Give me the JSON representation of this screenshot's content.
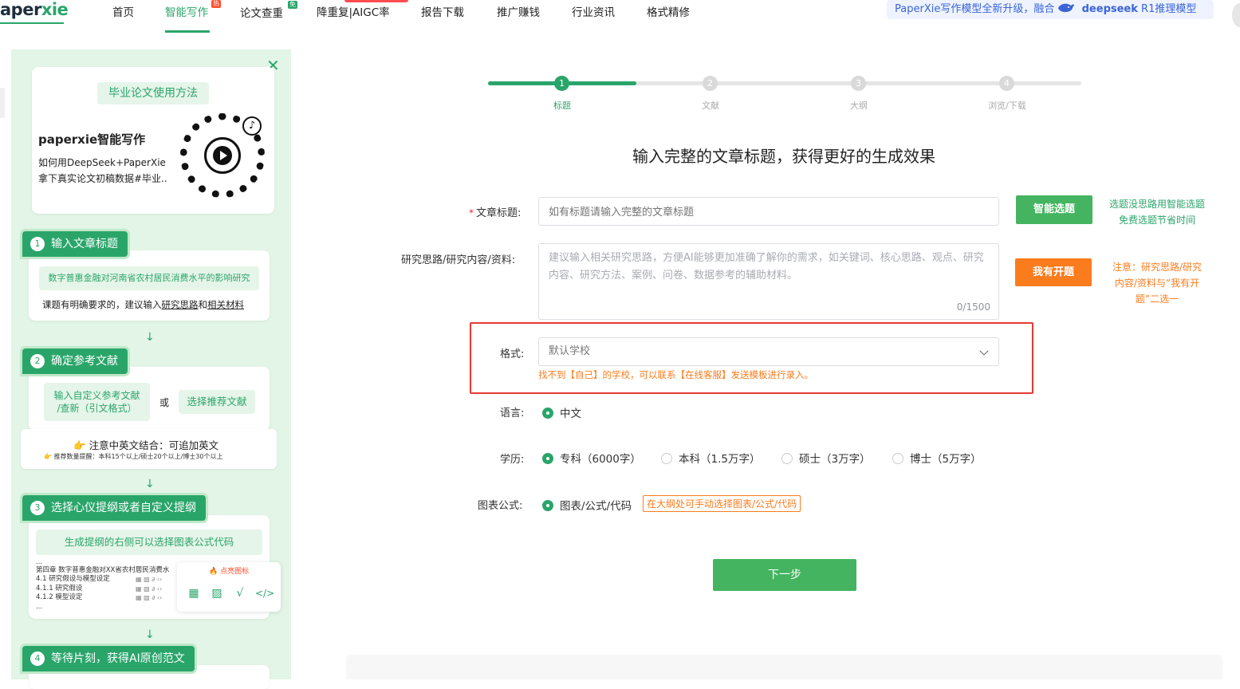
{
  "nav": {
    "logo_left": "aper",
    "logo_x": "xie",
    "items": [
      {
        "label": "首页"
      },
      {
        "label": "智能写作",
        "badge": "热"
      },
      {
        "label": "论文查重",
        "badge": "免"
      },
      {
        "label": "降重复|AIGC率"
      },
      {
        "label": "报告下载"
      },
      {
        "label": "推广赚钱"
      },
      {
        "label": "行业资讯"
      },
      {
        "label": "格式精修"
      }
    ],
    "promo_text": "PaperXie写作模型全新升级，融合",
    "promo_brand": "deepseek",
    "promo_suffix": "R1推理模型"
  },
  "guide": {
    "intro_pill": "毕业论文使用方法",
    "intro_title": "paperxie智能写作",
    "intro_line1": "如何用DeepSeek+PaperXie",
    "intro_line2": "拿下真实论文初稿数据#毕业..",
    "steps": [
      {
        "num": "1",
        "title": "输入文章标题"
      },
      {
        "num": "2",
        "title": "确定参考文献"
      },
      {
        "num": "3",
        "title": "选择心仪提纲或者自定义提纲"
      },
      {
        "num": "4",
        "title": "等待片刻，获得AI原创范文"
      }
    ],
    "step1_example": "数字普惠金融对河南省农村居民消费水平的影响研究",
    "step1_tip_prefix": "课题有明确要求的，建议输入",
    "step1_tip_link1": "研究思路",
    "step1_tip_and": "和",
    "step1_tip_link2": "相关材料",
    "step2_custom": "输入自定义参考文献\n/查新（引文格式）",
    "step2_or": "或",
    "step2_recommend": "选择推荐文献",
    "step2_note": "注意中英文结合：可追加英文",
    "step2_note_small": "推荐数量提醒：本科15个以上/硕士20个以上/博士30个以上",
    "step3_pill": "生成提纲的右侧可以选择图表公式代码",
    "step3_outline": [
      "...",
      "第四章 数字普惠金融对XX省农村居民消费水",
      "4.1 研究假设与模型设定",
      "4.1.1 研究假设",
      "4.1.2 模型设定",
      "..."
    ],
    "step3_click": "点亮图标"
  },
  "wizard": {
    "steps": [
      {
        "num": "1",
        "label": "标题"
      },
      {
        "num": "2",
        "label": "文献"
      },
      {
        "num": "3",
        "label": "大纲"
      },
      {
        "num": "4",
        "label": "浏览/下载"
      }
    ],
    "progress": 0.25
  },
  "form": {
    "heading": "输入完整的文章标题，获得更好的生成效果",
    "title_label": "文章标题:",
    "title_required": "*",
    "title_placeholder": "如有标题请输入完整的文章标题",
    "smart_btn": "智能选题",
    "smart_tip1": "选题没思路用智能选题",
    "smart_tip2": "免费选题节省时间",
    "research_label": "研究思路/研究内容/资料:",
    "research_placeholder": "建议输入相关研究思路，方便AI能够更加准确了解你的需求，如关键词、核心思路、观点、研究内容、研究方法、案例、问卷、数据参考的辅助材料。",
    "research_counter": "0/1500",
    "proposal_btn": "我有开题",
    "proposal_tip1": "注意：研究思路/研究",
    "proposal_tip2": "内容/资料与“我有开",
    "proposal_tip3": "题”二选一",
    "format_label": "格式:",
    "format_value": "默认学校",
    "format_hint": "找不到【自己】的学校，可以联系【在线客服】发送模板进行录入。",
    "language_label": "语言:",
    "language_value": "中文",
    "degree_label": "学历:",
    "degrees": [
      "专科（6000字）",
      "本科（1.5万字）",
      "硕士（3万字）",
      "博士（5万字）"
    ],
    "chart_label": "图表公式:",
    "chart_value": "图表/公式/代码",
    "chart_tag": "在大纲处可手动选择图表/公式/代码",
    "next_btn": "下一步"
  }
}
